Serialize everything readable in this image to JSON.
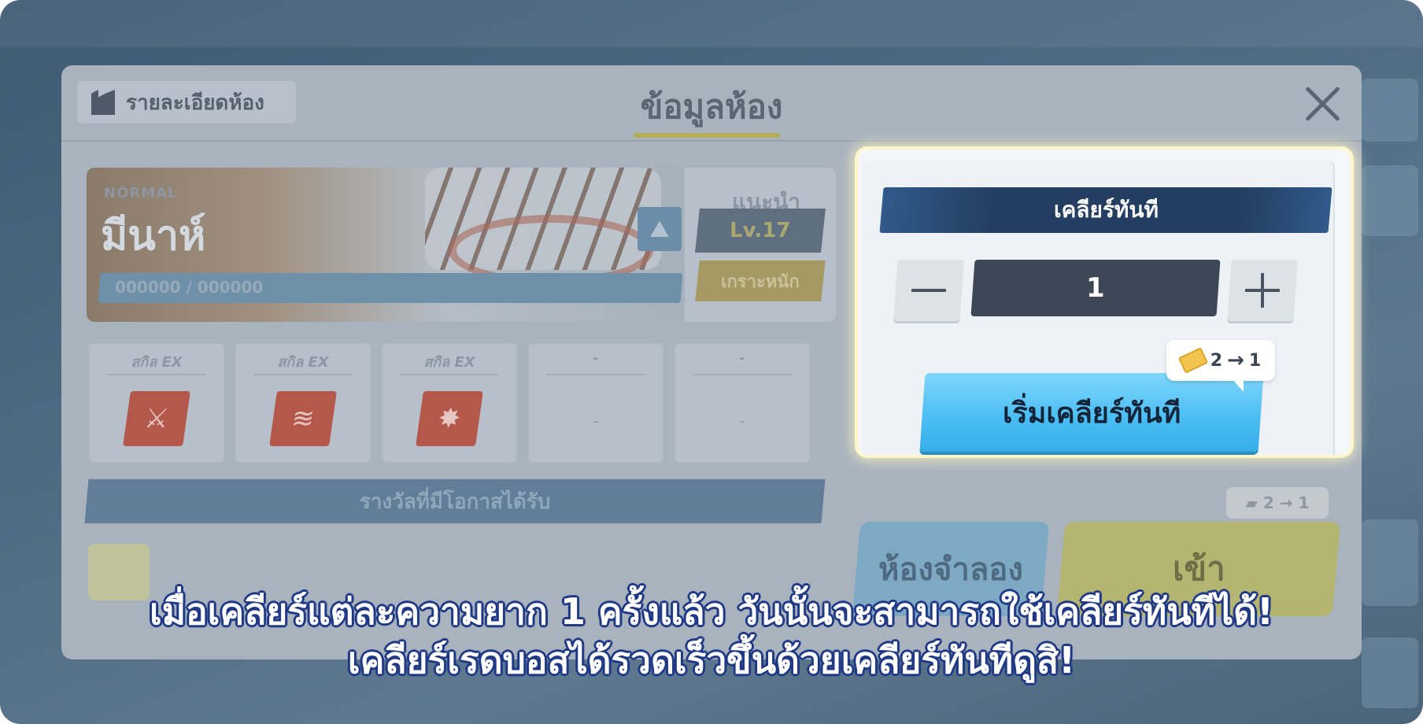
{
  "modal": {
    "tab_label": "รายละเอียดห้อง",
    "title": "ข้อมูลห้อง"
  },
  "boss": {
    "difficulty": "NORMAL",
    "name": "มีนาห์",
    "hp_text": "000000 / 000000",
    "recommend_label": "แนะนำ",
    "level": "Lv.17",
    "armor": "เกราะหนัก"
  },
  "skills": {
    "slots": [
      {
        "label": "สกิล EX",
        "icon": "attack-skill-icon"
      },
      {
        "label": "สกิล EX",
        "icon": "claw-skill-icon"
      },
      {
        "label": "สกิล EX",
        "icon": "explosion-skill-icon"
      },
      {
        "label": "-",
        "value": "-"
      },
      {
        "label": "-",
        "value": "-"
      }
    ]
  },
  "reward": {
    "label": "รางวัลที่มีโอกาสได้รับ"
  },
  "bottom": {
    "sim_room_label": "ห้องจำลอง",
    "enter_label": "เข้า",
    "enter_cost_from": "2",
    "enter_cost_to": "1"
  },
  "quick_clear": {
    "header": "เคลียร์ทันที",
    "quantity": "1",
    "cost_from": "2",
    "cost_to": "1",
    "start_label": "เริ่มเคลียร์ทันที"
  },
  "caption": {
    "line1": "เมื่อเคลียร์แต่ละความยาก 1 ครั้งแล้ว วันนั้นจะสามารถใช้เคลียร์ทันทีได้!",
    "line2": "เคลียร์เรดบอสได้รวดเร็วขึ้นด้วยเคลียร์ทันทีดูสิ!"
  },
  "colors": {
    "highlight_glow": "#fff7c9",
    "start_button": "#49bdf3",
    "header_navy": "#243e62",
    "caption_outline": "#213a86"
  }
}
